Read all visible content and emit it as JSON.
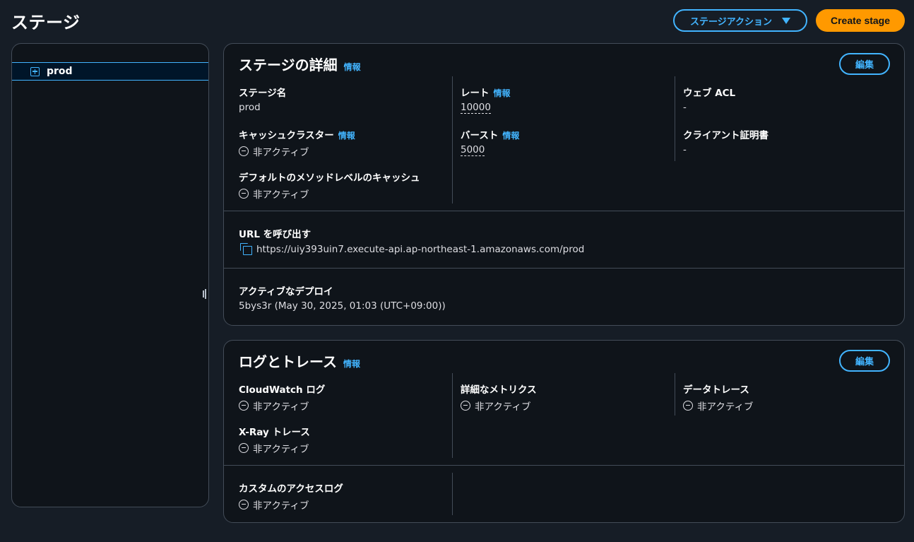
{
  "header": {
    "title": "ステージ",
    "actions_label": "ステージアクション",
    "create_label": "Create stage"
  },
  "tree": {
    "items": [
      {
        "label": "prod"
      }
    ]
  },
  "stage_details": {
    "title": "ステージの詳細",
    "info": "情報",
    "edit_label": "編集",
    "stage_name": {
      "label": "ステージ名",
      "value": "prod"
    },
    "cache_cluster": {
      "label": "キャッシュクラスター",
      "info": "情報",
      "value": "非アクティブ"
    },
    "default_method_cache": {
      "label": "デフォルトのメソッドレベルのキャッシュ",
      "value": "非アクティブ"
    },
    "rate": {
      "label": "レート",
      "info": "情報",
      "value": "10000"
    },
    "burst": {
      "label": "バースト",
      "info": "情報",
      "value": "5000"
    },
    "web_acl": {
      "label": "ウェブ ACL",
      "value": "-"
    },
    "client_cert": {
      "label": "クライアント証明書",
      "value": "-"
    },
    "invoke_url": {
      "label": "URL を呼び出す",
      "value": "https://uiy393uin7.execute-api.ap-northeast-1.amazonaws.com/prod"
    },
    "active_deployment": {
      "label": "アクティブなデプロイ",
      "value": "5bys3r (May 30, 2025, 01:03 (UTC+09:00))"
    }
  },
  "logs_tracing": {
    "title": "ログとトレース",
    "info": "情報",
    "edit_label": "編集",
    "cloudwatch_logs": {
      "label": "CloudWatch ログ",
      "value": "非アクティブ"
    },
    "xray_tracing": {
      "label": "X-Ray トレース",
      "value": "非アクティブ"
    },
    "detailed_metrics": {
      "label": "詳細なメトリクス",
      "value": "非アクティブ"
    },
    "data_trace": {
      "label": "データトレース",
      "value": "非アクティブ"
    },
    "custom_access_logs": {
      "label": "カスタムのアクセスログ",
      "value": "非アクティブ"
    }
  },
  "colors": {
    "background": "#161d26",
    "container": "#0f141a",
    "accent": "#42b4ff",
    "primary_button": "#ff9900",
    "border": "#434c58"
  }
}
